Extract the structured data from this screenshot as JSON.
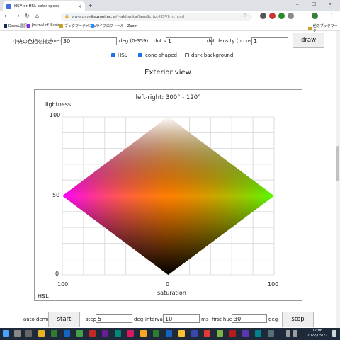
{
  "browser": {
    "tab_title": "HSV or HSL color space",
    "tab_close": "×",
    "new_tab": "+",
    "url_prefix": "www.psy.",
    "url_host": "ritsumei.ac.jp",
    "url_path": "/~akitaoka/JavaScript-HSVfrm.html",
    "bookmarks": [
      "DeepL翻訳",
      "Journal of Illusion",
      "ブックマークメニュー",
      "マイプロフィール - Zoom"
    ],
    "other_bookmarks": "他のブックマーク"
  },
  "controls": {
    "center_label": "中央の色相を指定",
    "hue_label": "hue:",
    "hue_value": "30",
    "hue_unit": "deg (0-359)",
    "dot_size_label": "dot size (fixed)",
    "dot_size_value": "1",
    "dot_density_label": "dot density (no use)",
    "dot_density_value": "1",
    "draw_button": "draw",
    "hsl_label": "HSL",
    "hsl_checked": true,
    "cone_label": "cone-shaped",
    "cone_checked": true,
    "dark_label": "dark background",
    "dark_checked": false
  },
  "view_title": "Exterior view",
  "plot": {
    "title": "left-right: 300° - 120°",
    "y_axis_label": "lightness",
    "x_axis_label": "saturation",
    "y_ticks": [
      "100",
      "50",
      "0"
    ],
    "x_ticks": [
      "100",
      "0",
      "100"
    ],
    "mode_label": "HSL",
    "colors": {
      "top": "#ffffff",
      "bottom": "#000000",
      "left": "#ff00ff",
      "right": "#55ff00",
      "center": "#ff8000"
    }
  },
  "auto_demo": {
    "label": "auto demo:",
    "start_button": "start",
    "step_label": "step",
    "step_value": "5",
    "step_unit": "deg",
    "interval_label": "interval",
    "interval_value": "10",
    "interval_unit": "ms",
    "first_hue_label": "first hue",
    "first_hue_value": "30",
    "first_hue_unit": "deg",
    "stop_button": "stop"
  },
  "taskbar": {
    "time": "17:06",
    "date": "2022/05/27"
  }
}
